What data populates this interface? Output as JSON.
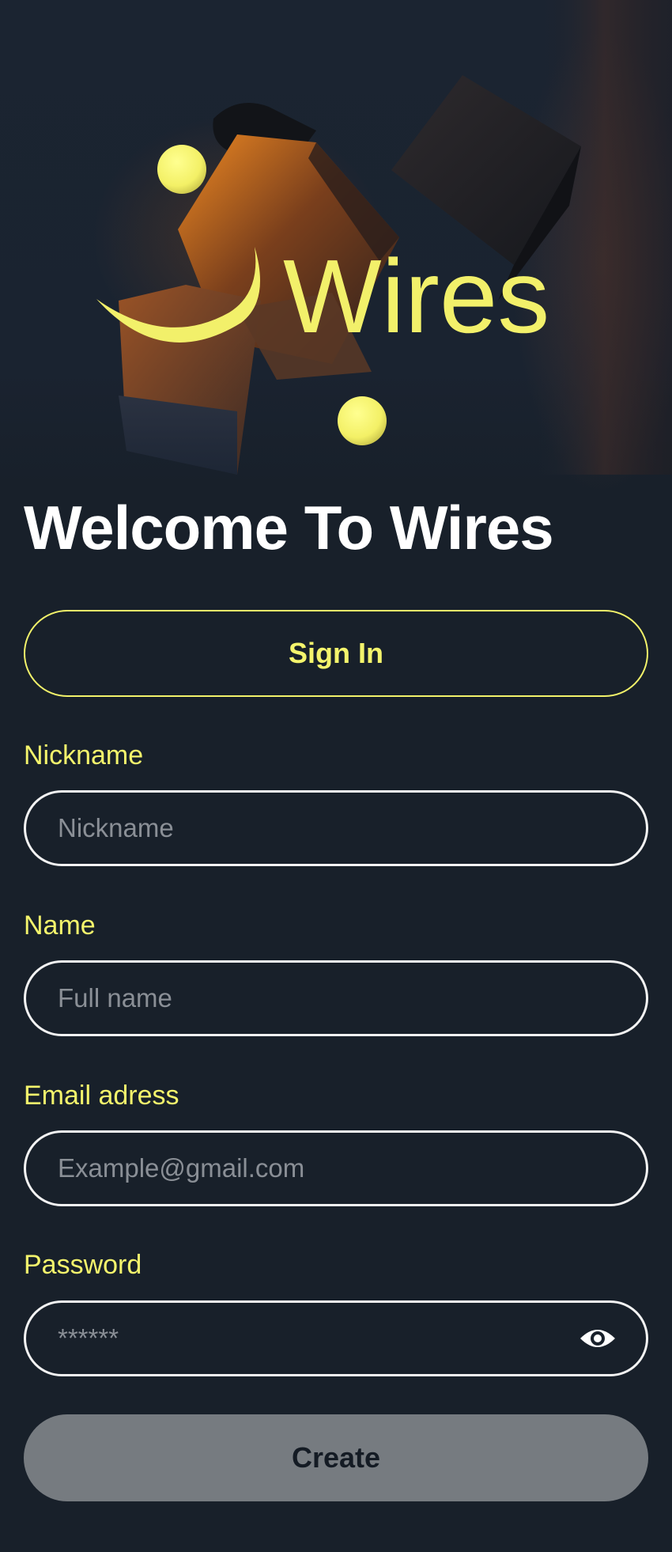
{
  "brand": {
    "logo_text": "Wires",
    "accent_color": "#f4f46c",
    "background_color": "#18202a"
  },
  "hero": {
    "illustration": "floating-dark-cubes-with-yellow-orbs",
    "logo_icon": "smile-arc-icon"
  },
  "welcome": {
    "title": "Welcome To Wires"
  },
  "signin": {
    "label": "Sign In"
  },
  "form": {
    "nickname": {
      "label": "Nickname",
      "placeholder": "Nickname",
      "value": ""
    },
    "name": {
      "label": "Name",
      "placeholder": "Full name",
      "value": ""
    },
    "email": {
      "label": "Email adress",
      "placeholder": "Example@gmail.com",
      "value": ""
    },
    "password": {
      "label": "Password",
      "placeholder": "******",
      "value": "",
      "toggle_icon": "eye-icon"
    }
  },
  "create": {
    "label": "Create",
    "state": "disabled"
  }
}
